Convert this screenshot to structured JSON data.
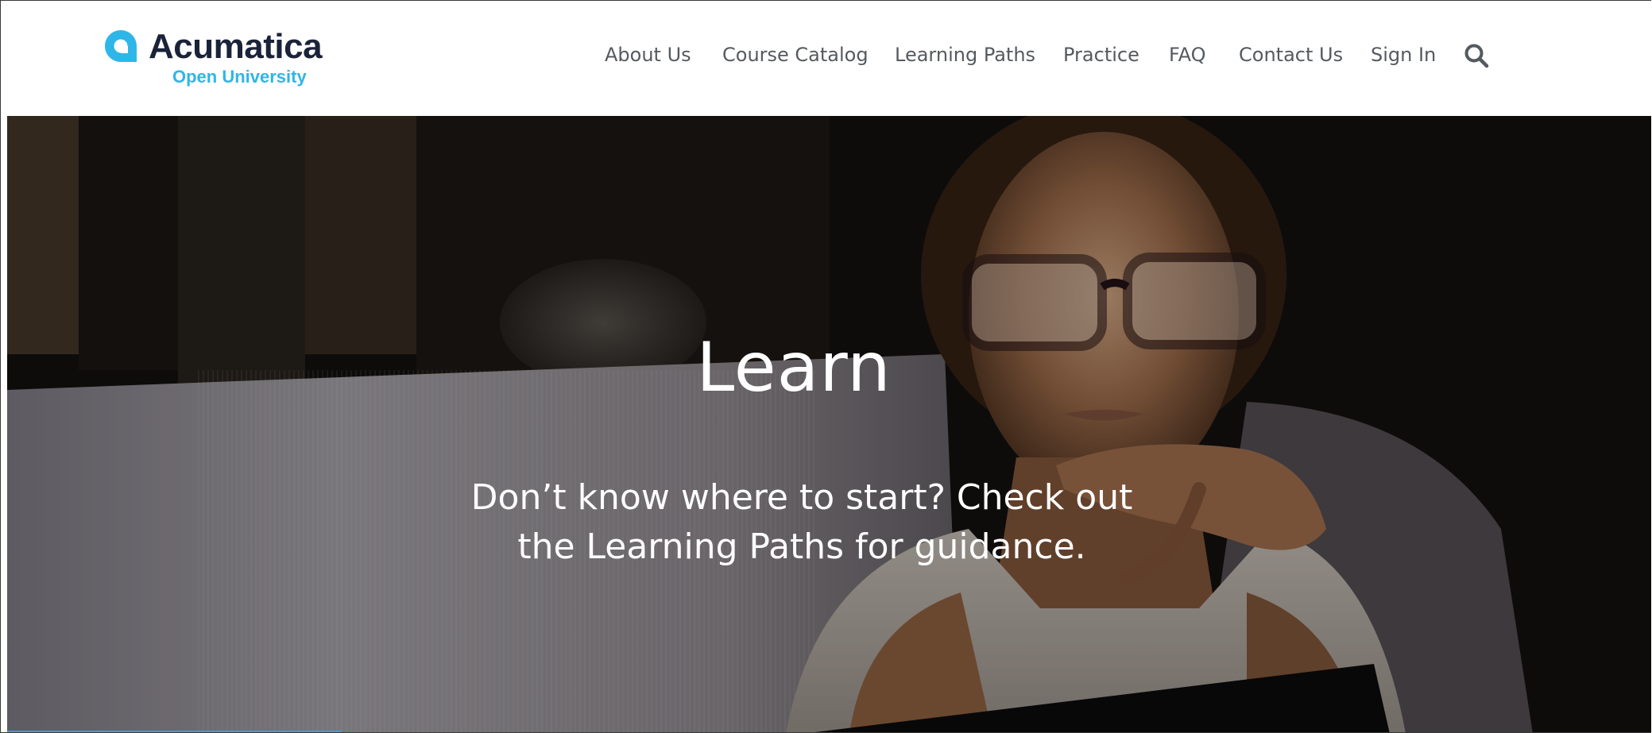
{
  "brand": {
    "name": "Acumatica",
    "subtitle": "Open University",
    "primary_color": "#1b2339",
    "accent_color": "#2fb6e8"
  },
  "nav": {
    "items": [
      {
        "label": "About Us"
      },
      {
        "label": "Course Catalog"
      },
      {
        "label": "Learning Paths"
      },
      {
        "label": "Practice"
      },
      {
        "label": "FAQ"
      },
      {
        "label": "Contact Us"
      },
      {
        "label": "Sign In"
      }
    ],
    "search_icon": "search-icon"
  },
  "hero": {
    "title": "Learn",
    "subtitle_line1": "Don’t know where to start? Check out",
    "subtitle_line2": "the Learning Paths for guidance.",
    "image": "woman-with-glasses-studying-at-laptop-at-night"
  }
}
